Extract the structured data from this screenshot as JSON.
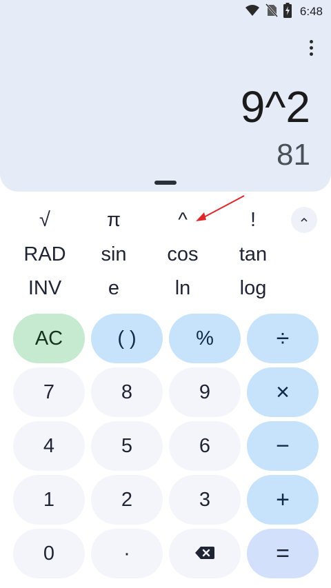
{
  "status_bar": {
    "time": "6:48",
    "icons": [
      "wifi-icon",
      "no-sim-icon",
      "battery-charging-icon"
    ]
  },
  "display": {
    "expression": "9^2",
    "result": "81"
  },
  "scientific": {
    "row1": [
      "√",
      "π",
      "^",
      "!"
    ],
    "row2": [
      "RAD",
      "sin",
      "cos",
      "tan"
    ],
    "row3": [
      "INV",
      "e",
      "ln",
      "log"
    ],
    "collapse_symbol": "^"
  },
  "keypad": {
    "row1": [
      "AC",
      "( )",
      "%",
      "÷"
    ],
    "row2": [
      "7",
      "8",
      "9",
      "×"
    ],
    "row3": [
      "4",
      "5",
      "6",
      "−"
    ],
    "row4": [
      "1",
      "2",
      "3",
      "+"
    ],
    "row5": [
      "0",
      "·",
      "backspace-icon",
      "="
    ]
  },
  "colors": {
    "display_bg": "#e5ebf7",
    "clear_key": "#c5ead0",
    "operator_key": "#c7e3fb",
    "digit_key": "#f3f5fa",
    "equals_key": "#d2e0fb",
    "annotation_arrow": "#e0262b"
  }
}
